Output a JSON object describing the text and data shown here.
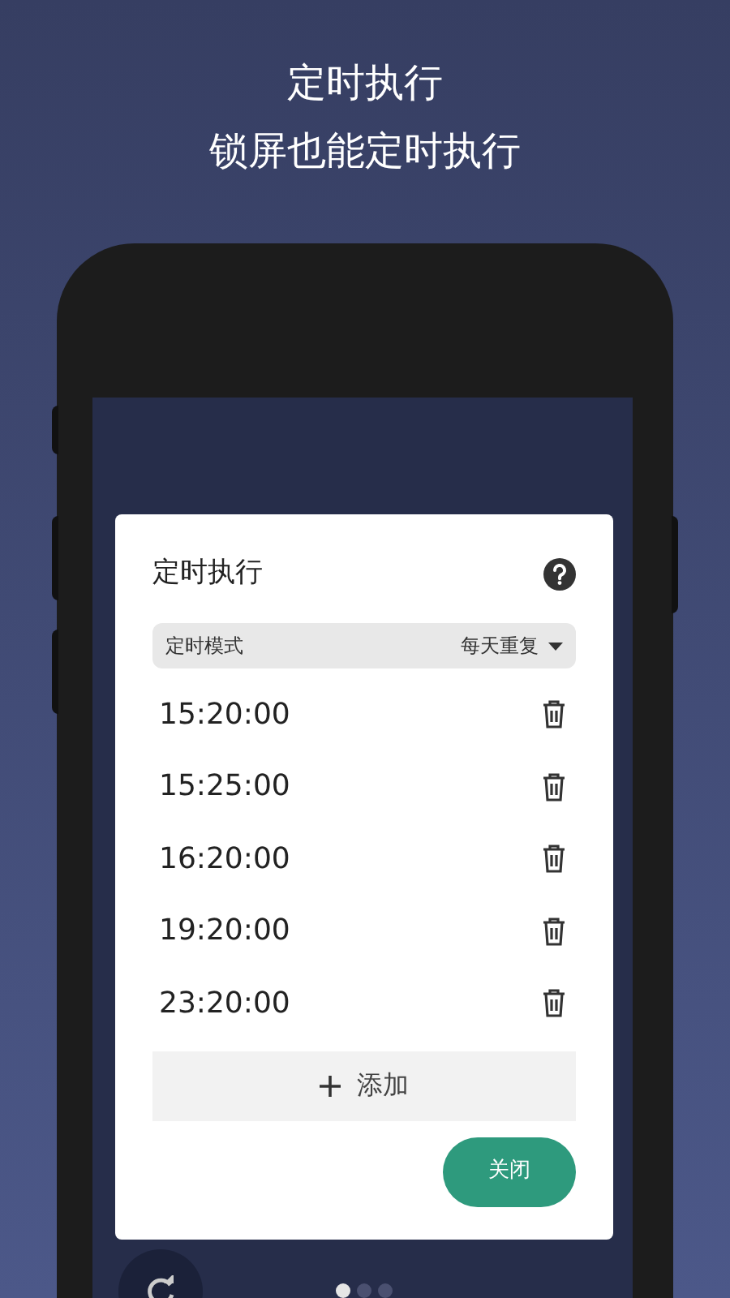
{
  "headline": [
    "定时执行",
    "锁屏也能定时执行"
  ],
  "dialog": {
    "title": "定时执行",
    "mode": {
      "label": "定时模式",
      "value": "每天重复"
    },
    "times": [
      "15:20:00",
      "15:25:00",
      "16:20:00",
      "19:20:00",
      "23:20:00"
    ],
    "add_button": "添加",
    "close_button": "关闭"
  },
  "page_dots": [
    {
      "selected": true
    },
    {
      "selected": false
    },
    {
      "selected": false
    }
  ]
}
